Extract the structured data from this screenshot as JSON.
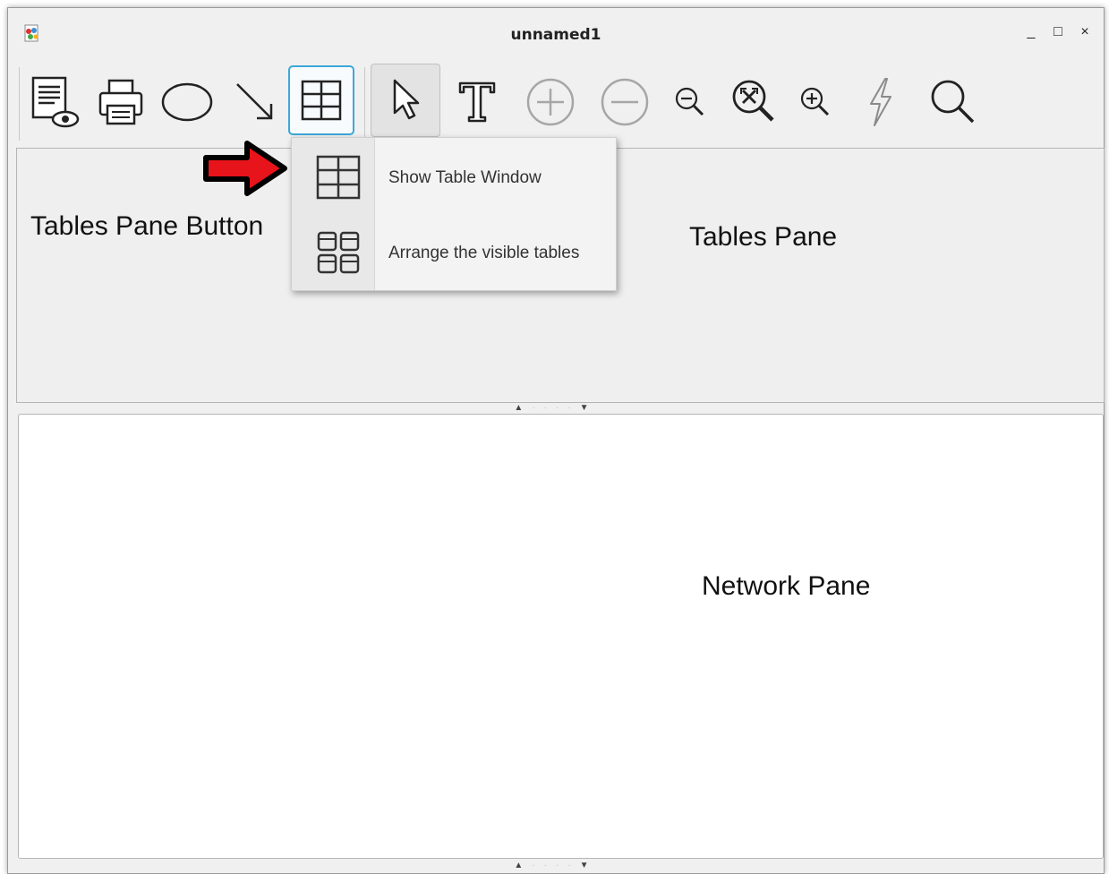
{
  "window": {
    "title": "unnamed1",
    "controls": {
      "minimize": "_",
      "maximize": "□",
      "close": "×"
    }
  },
  "toolbar": {
    "buttons": [
      {
        "name": "print-preview",
        "icon": "document-eye-icon"
      },
      {
        "name": "print",
        "icon": "printer-icon"
      },
      {
        "name": "ellipse",
        "icon": "ellipse-icon"
      },
      {
        "name": "arrow",
        "icon": "diagonal-arrow-icon"
      },
      {
        "name": "tables-pane",
        "icon": "table-grid-icon",
        "state": "active"
      },
      {
        "name": "select",
        "icon": "cursor-icon",
        "state": "pressed"
      },
      {
        "name": "text",
        "icon": "text-t-icon"
      },
      {
        "name": "add",
        "icon": "plus-circle-icon"
      },
      {
        "name": "remove",
        "icon": "minus-circle-icon"
      },
      {
        "name": "zoom-out",
        "icon": "zoom-out-icon"
      },
      {
        "name": "zoom-fit",
        "icon": "zoom-fit-icon"
      },
      {
        "name": "zoom-in",
        "icon": "zoom-in-icon"
      },
      {
        "name": "lightning",
        "icon": "lightning-icon"
      },
      {
        "name": "search",
        "icon": "search-icon"
      }
    ]
  },
  "menu": {
    "items": [
      {
        "label": "Show Table Window",
        "icon": "table-grid-icon"
      },
      {
        "label": "Arrange the visible tables",
        "icon": "arrange-tables-icon"
      }
    ]
  },
  "annotations": {
    "tables_pane_button": "Tables Pane Button",
    "tables_pane": "Tables Pane",
    "network_pane": "Network Pane"
  },
  "colors": {
    "accent_border": "#3ca7d9",
    "arrow_fill": "#e8141b",
    "pane_bg": "#efefef",
    "network_bg": "#ffffff"
  }
}
